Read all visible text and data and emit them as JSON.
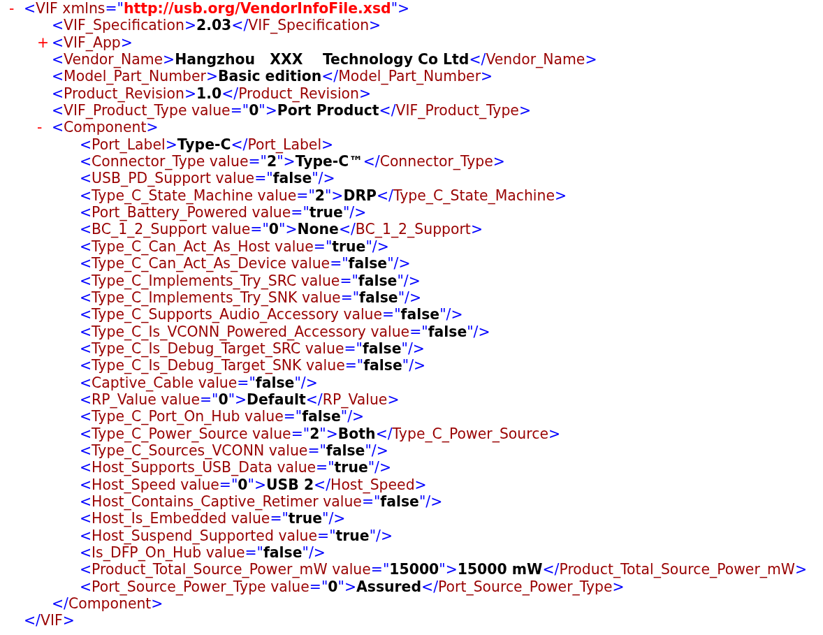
{
  "document": {
    "toggle": "-",
    "line": [
      {
        "kind": "punct",
        "text": "<"
      },
      {
        "kind": "tag",
        "text": "VIF"
      },
      {
        "kind": "attr",
        "text": "xmlns"
      },
      {
        "kind": "punct",
        "text": "=\""
      },
      {
        "kind": "url",
        "text": "http://usb.org/VendorInfoFile.xsd"
      },
      {
        "kind": "punct",
        "text": "\">"
      }
    ],
    "children": [
      {
        "line": [
          {
            "kind": "punct",
            "text": "<"
          },
          {
            "kind": "tag",
            "text": "VIF_Specification"
          },
          {
            "kind": "punct",
            "text": ">"
          },
          {
            "kind": "content",
            "text": "2.03"
          },
          {
            "kind": "punct",
            "text": "</"
          },
          {
            "kind": "tag",
            "text": "VIF_Specification"
          },
          {
            "kind": "punct",
            "text": ">"
          }
        ]
      },
      {
        "toggle": "+",
        "line": [
          {
            "kind": "punct",
            "text": "<"
          },
          {
            "kind": "tag",
            "text": "VIF_App"
          },
          {
            "kind": "punct",
            "text": ">"
          }
        ]
      },
      {
        "line": [
          {
            "kind": "punct",
            "text": "<"
          },
          {
            "kind": "tag",
            "text": "Vendor_Name"
          },
          {
            "kind": "punct",
            "text": ">"
          },
          {
            "kind": "content",
            "text": "Hangzhou   XXX    Technology Co Ltd"
          },
          {
            "kind": "punct",
            "text": "</"
          },
          {
            "kind": "tag",
            "text": "Vendor_Name"
          },
          {
            "kind": "punct",
            "text": ">"
          }
        ]
      },
      {
        "line": [
          {
            "kind": "punct",
            "text": "<"
          },
          {
            "kind": "tag",
            "text": "Model_Part_Number"
          },
          {
            "kind": "punct",
            "text": ">"
          },
          {
            "kind": "content",
            "text": "Basic edition"
          },
          {
            "kind": "punct",
            "text": "</"
          },
          {
            "kind": "tag",
            "text": "Model_Part_Number"
          },
          {
            "kind": "punct",
            "text": ">"
          }
        ]
      },
      {
        "line": [
          {
            "kind": "punct",
            "text": "<"
          },
          {
            "kind": "tag",
            "text": "Product_Revision"
          },
          {
            "kind": "punct",
            "text": ">"
          },
          {
            "kind": "content",
            "text": "1.0"
          },
          {
            "kind": "punct",
            "text": "</"
          },
          {
            "kind": "tag",
            "text": "Product_Revision"
          },
          {
            "kind": "punct",
            "text": ">"
          }
        ]
      },
      {
        "line": [
          {
            "kind": "punct",
            "text": "<"
          },
          {
            "kind": "tag",
            "text": "VIF_Product_Type"
          },
          {
            "kind": "attr",
            "text": "value"
          },
          {
            "kind": "punct",
            "text": "=\""
          },
          {
            "kind": "value",
            "text": "0"
          },
          {
            "kind": "punct",
            "text": "\">"
          },
          {
            "kind": "content",
            "text": "Port Product"
          },
          {
            "kind": "punct",
            "text": "</"
          },
          {
            "kind": "tag",
            "text": "VIF_Product_Type"
          },
          {
            "kind": "punct",
            "text": ">"
          }
        ]
      },
      {
        "toggle": "-",
        "line": [
          {
            "kind": "punct",
            "text": "<"
          },
          {
            "kind": "tag",
            "text": "Component"
          },
          {
            "kind": "punct",
            "text": ">"
          }
        ],
        "children": [
          {
            "line": [
              {
                "kind": "punct",
                "text": "<"
              },
              {
                "kind": "tag",
                "text": "Port_Label"
              },
              {
                "kind": "punct",
                "text": ">"
              },
              {
                "kind": "content",
                "text": "Type-C"
              },
              {
                "kind": "punct",
                "text": "</"
              },
              {
                "kind": "tag",
                "text": "Port_Label"
              },
              {
                "kind": "punct",
                "text": ">"
              }
            ]
          },
          {
            "line": [
              {
                "kind": "punct",
                "text": "<"
              },
              {
                "kind": "tag",
                "text": "Connector_Type"
              },
              {
                "kind": "attr",
                "text": "value"
              },
              {
                "kind": "punct",
                "text": "=\""
              },
              {
                "kind": "value",
                "text": "2"
              },
              {
                "kind": "punct",
                "text": "\">"
              },
              {
                "kind": "content",
                "text": "Type-C™"
              },
              {
                "kind": "punct",
                "text": "</"
              },
              {
                "kind": "tag",
                "text": "Connector_Type"
              },
              {
                "kind": "punct",
                "text": ">"
              }
            ]
          },
          {
            "line": [
              {
                "kind": "punct",
                "text": "<"
              },
              {
                "kind": "tag",
                "text": "USB_PD_Support"
              },
              {
                "kind": "attr",
                "text": "value"
              },
              {
                "kind": "punct",
                "text": "=\""
              },
              {
                "kind": "value",
                "text": "false"
              },
              {
                "kind": "punct",
                "text": "\"/>"
              }
            ]
          },
          {
            "line": [
              {
                "kind": "punct",
                "text": "<"
              },
              {
                "kind": "tag",
                "text": "Type_C_State_Machine"
              },
              {
                "kind": "attr",
                "text": "value"
              },
              {
                "kind": "punct",
                "text": "=\""
              },
              {
                "kind": "value",
                "text": "2"
              },
              {
                "kind": "punct",
                "text": "\">"
              },
              {
                "kind": "content",
                "text": "DRP"
              },
              {
                "kind": "punct",
                "text": "</"
              },
              {
                "kind": "tag",
                "text": "Type_C_State_Machine"
              },
              {
                "kind": "punct",
                "text": ">"
              }
            ]
          },
          {
            "line": [
              {
                "kind": "punct",
                "text": "<"
              },
              {
                "kind": "tag",
                "text": "Port_Battery_Powered"
              },
              {
                "kind": "attr",
                "text": "value"
              },
              {
                "kind": "punct",
                "text": "=\""
              },
              {
                "kind": "value",
                "text": "true"
              },
              {
                "kind": "punct",
                "text": "\"/>"
              }
            ]
          },
          {
            "line": [
              {
                "kind": "punct",
                "text": "<"
              },
              {
                "kind": "tag",
                "text": "BC_1_2_Support"
              },
              {
                "kind": "attr",
                "text": "value"
              },
              {
                "kind": "punct",
                "text": "=\""
              },
              {
                "kind": "value",
                "text": "0"
              },
              {
                "kind": "punct",
                "text": "\">"
              },
              {
                "kind": "content",
                "text": "None"
              },
              {
                "kind": "punct",
                "text": "</"
              },
              {
                "kind": "tag",
                "text": "BC_1_2_Support"
              },
              {
                "kind": "punct",
                "text": ">"
              }
            ]
          },
          {
            "line": [
              {
                "kind": "punct",
                "text": "<"
              },
              {
                "kind": "tag",
                "text": "Type_C_Can_Act_As_Host"
              },
              {
                "kind": "attr",
                "text": "value"
              },
              {
                "kind": "punct",
                "text": "=\""
              },
              {
                "kind": "value",
                "text": "true"
              },
              {
                "kind": "punct",
                "text": "\"/>"
              }
            ]
          },
          {
            "line": [
              {
                "kind": "punct",
                "text": "<"
              },
              {
                "kind": "tag",
                "text": "Type_C_Can_Act_As_Device"
              },
              {
                "kind": "attr",
                "text": "value"
              },
              {
                "kind": "punct",
                "text": "=\""
              },
              {
                "kind": "value",
                "text": "false"
              },
              {
                "kind": "punct",
                "text": "\"/>"
              }
            ]
          },
          {
            "line": [
              {
                "kind": "punct",
                "text": "<"
              },
              {
                "kind": "tag",
                "text": "Type_C_Implements_Try_SRC"
              },
              {
                "kind": "attr",
                "text": "value"
              },
              {
                "kind": "punct",
                "text": "=\""
              },
              {
                "kind": "value",
                "text": "false"
              },
              {
                "kind": "punct",
                "text": "\"/>"
              }
            ]
          },
          {
            "line": [
              {
                "kind": "punct",
                "text": "<"
              },
              {
                "kind": "tag",
                "text": "Type_C_Implements_Try_SNK"
              },
              {
                "kind": "attr",
                "text": "value"
              },
              {
                "kind": "punct",
                "text": "=\""
              },
              {
                "kind": "value",
                "text": "false"
              },
              {
                "kind": "punct",
                "text": "\"/>"
              }
            ]
          },
          {
            "line": [
              {
                "kind": "punct",
                "text": "<"
              },
              {
                "kind": "tag",
                "text": "Type_C_Supports_Audio_Accessory"
              },
              {
                "kind": "attr",
                "text": "value"
              },
              {
                "kind": "punct",
                "text": "=\""
              },
              {
                "kind": "value",
                "text": "false"
              },
              {
                "kind": "punct",
                "text": "\"/>"
              }
            ]
          },
          {
            "line": [
              {
                "kind": "punct",
                "text": "<"
              },
              {
                "kind": "tag",
                "text": "Type_C_Is_VCONN_Powered_Accessory"
              },
              {
                "kind": "attr",
                "text": "value"
              },
              {
                "kind": "punct",
                "text": "=\""
              },
              {
                "kind": "value",
                "text": "false"
              },
              {
                "kind": "punct",
                "text": "\"/>"
              }
            ]
          },
          {
            "line": [
              {
                "kind": "punct",
                "text": "<"
              },
              {
                "kind": "tag",
                "text": "Type_C_Is_Debug_Target_SRC"
              },
              {
                "kind": "attr",
                "text": "value"
              },
              {
                "kind": "punct",
                "text": "=\""
              },
              {
                "kind": "value",
                "text": "false"
              },
              {
                "kind": "punct",
                "text": "\"/>"
              }
            ]
          },
          {
            "line": [
              {
                "kind": "punct",
                "text": "<"
              },
              {
                "kind": "tag",
                "text": "Type_C_Is_Debug_Target_SNK"
              },
              {
                "kind": "attr",
                "text": "value"
              },
              {
                "kind": "punct",
                "text": "=\""
              },
              {
                "kind": "value",
                "text": "false"
              },
              {
                "kind": "punct",
                "text": "\"/>"
              }
            ]
          },
          {
            "line": [
              {
                "kind": "punct",
                "text": "<"
              },
              {
                "kind": "tag",
                "text": "Captive_Cable"
              },
              {
                "kind": "attr",
                "text": "value"
              },
              {
                "kind": "punct",
                "text": "=\""
              },
              {
                "kind": "value",
                "text": "false"
              },
              {
                "kind": "punct",
                "text": "\"/>"
              }
            ]
          },
          {
            "line": [
              {
                "kind": "punct",
                "text": "<"
              },
              {
                "kind": "tag",
                "text": "RP_Value"
              },
              {
                "kind": "attr",
                "text": "value"
              },
              {
                "kind": "punct",
                "text": "=\""
              },
              {
                "kind": "value",
                "text": "0"
              },
              {
                "kind": "punct",
                "text": "\">"
              },
              {
                "kind": "content",
                "text": "Default"
              },
              {
                "kind": "punct",
                "text": "</"
              },
              {
                "kind": "tag",
                "text": "RP_Value"
              },
              {
                "kind": "punct",
                "text": ">"
              }
            ]
          },
          {
            "line": [
              {
                "kind": "punct",
                "text": "<"
              },
              {
                "kind": "tag",
                "text": "Type_C_Port_On_Hub"
              },
              {
                "kind": "attr",
                "text": "value"
              },
              {
                "kind": "punct",
                "text": "=\""
              },
              {
                "kind": "value",
                "text": "false"
              },
              {
                "kind": "punct",
                "text": "\"/>"
              }
            ]
          },
          {
            "line": [
              {
                "kind": "punct",
                "text": "<"
              },
              {
                "kind": "tag",
                "text": "Type_C_Power_Source"
              },
              {
                "kind": "attr",
                "text": "value"
              },
              {
                "kind": "punct",
                "text": "=\""
              },
              {
                "kind": "value",
                "text": "2"
              },
              {
                "kind": "punct",
                "text": "\">"
              },
              {
                "kind": "content",
                "text": "Both"
              },
              {
                "kind": "punct",
                "text": "</"
              },
              {
                "kind": "tag",
                "text": "Type_C_Power_Source"
              },
              {
                "kind": "punct",
                "text": ">"
              }
            ]
          },
          {
            "line": [
              {
                "kind": "punct",
                "text": "<"
              },
              {
                "kind": "tag",
                "text": "Type_C_Sources_VCONN"
              },
              {
                "kind": "attr",
                "text": "value"
              },
              {
                "kind": "punct",
                "text": "=\""
              },
              {
                "kind": "value",
                "text": "false"
              },
              {
                "kind": "punct",
                "text": "\"/>"
              }
            ]
          },
          {
            "line": [
              {
                "kind": "punct",
                "text": "<"
              },
              {
                "kind": "tag",
                "text": "Host_Supports_USB_Data"
              },
              {
                "kind": "attr",
                "text": "value"
              },
              {
                "kind": "punct",
                "text": "=\""
              },
              {
                "kind": "value",
                "text": "true"
              },
              {
                "kind": "punct",
                "text": "\"/>"
              }
            ]
          },
          {
            "line": [
              {
                "kind": "punct",
                "text": "<"
              },
              {
                "kind": "tag",
                "text": "Host_Speed"
              },
              {
                "kind": "attr",
                "text": "value"
              },
              {
                "kind": "punct",
                "text": "=\""
              },
              {
                "kind": "value",
                "text": "0"
              },
              {
                "kind": "punct",
                "text": "\">"
              },
              {
                "kind": "content",
                "text": "USB 2"
              },
              {
                "kind": "punct",
                "text": "</"
              },
              {
                "kind": "tag",
                "text": "Host_Speed"
              },
              {
                "kind": "punct",
                "text": ">"
              }
            ]
          },
          {
            "line": [
              {
                "kind": "punct",
                "text": "<"
              },
              {
                "kind": "tag",
                "text": "Host_Contains_Captive_Retimer"
              },
              {
                "kind": "attr",
                "text": "value"
              },
              {
                "kind": "punct",
                "text": "=\""
              },
              {
                "kind": "value",
                "text": "false"
              },
              {
                "kind": "punct",
                "text": "\"/>"
              }
            ]
          },
          {
            "line": [
              {
                "kind": "punct",
                "text": "<"
              },
              {
                "kind": "tag",
                "text": "Host_Is_Embedded"
              },
              {
                "kind": "attr",
                "text": "value"
              },
              {
                "kind": "punct",
                "text": "=\""
              },
              {
                "kind": "value",
                "text": "true"
              },
              {
                "kind": "punct",
                "text": "\"/>"
              }
            ]
          },
          {
            "line": [
              {
                "kind": "punct",
                "text": "<"
              },
              {
                "kind": "tag",
                "text": "Host_Suspend_Supported"
              },
              {
                "kind": "attr",
                "text": "value"
              },
              {
                "kind": "punct",
                "text": "=\""
              },
              {
                "kind": "value",
                "text": "true"
              },
              {
                "kind": "punct",
                "text": "\"/>"
              }
            ]
          },
          {
            "line": [
              {
                "kind": "punct",
                "text": "<"
              },
              {
                "kind": "tag",
                "text": "Is_DFP_On_Hub"
              },
              {
                "kind": "attr",
                "text": "value"
              },
              {
                "kind": "punct",
                "text": "=\""
              },
              {
                "kind": "value",
                "text": "false"
              },
              {
                "kind": "punct",
                "text": "\"/>"
              }
            ]
          },
          {
            "line": [
              {
                "kind": "punct",
                "text": "<"
              },
              {
                "kind": "tag",
                "text": "Product_Total_Source_Power_mW"
              },
              {
                "kind": "attr",
                "text": "value"
              },
              {
                "kind": "punct",
                "text": "=\""
              },
              {
                "kind": "value",
                "text": "15000"
              },
              {
                "kind": "punct",
                "text": "\">"
              },
              {
                "kind": "content",
                "text": "15000 mW"
              },
              {
                "kind": "punct",
                "text": "</"
              },
              {
                "kind": "tag",
                "text": "Product_Total_Source_Power_mW"
              },
              {
                "kind": "punct",
                "text": ">"
              }
            ]
          },
          {
            "line": [
              {
                "kind": "punct",
                "text": "<"
              },
              {
                "kind": "tag",
                "text": "Port_Source_Power_Type"
              },
              {
                "kind": "attr",
                "text": "value"
              },
              {
                "kind": "punct",
                "text": "=\""
              },
              {
                "kind": "value",
                "text": "0"
              },
              {
                "kind": "punct",
                "text": "\">"
              },
              {
                "kind": "content",
                "text": "Assured"
              },
              {
                "kind": "punct",
                "text": "</"
              },
              {
                "kind": "tag",
                "text": "Port_Source_Power_Type"
              },
              {
                "kind": "punct",
                "text": ">"
              }
            ]
          }
        ],
        "end": [
          {
            "kind": "punct",
            "text": "</"
          },
          {
            "kind": "tag",
            "text": "Component"
          },
          {
            "kind": "punct",
            "text": ">"
          }
        ]
      }
    ],
    "end": [
      {
        "kind": "punct",
        "text": "</"
      },
      {
        "kind": "tag",
        "text": "VIF"
      },
      {
        "kind": "punct",
        "text": ">"
      }
    ]
  }
}
